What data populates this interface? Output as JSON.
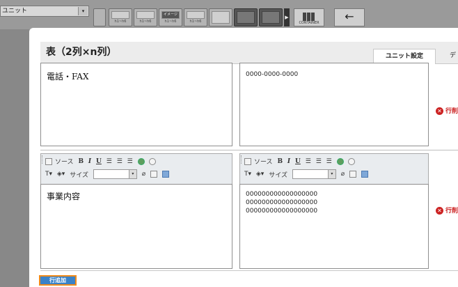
{
  "toolbar": {
    "unit_select_value": "ユニット",
    "buttons": [
      {
        "label": "h1~h6"
      },
      {
        "label": "h1~h6"
      },
      {
        "label": "h1~h6"
      },
      {
        "label": "h1~h6"
      }
    ],
    "image_badge": "イメージ",
    "container_label": "CONTAINER",
    "back_arrow": "←"
  },
  "panel": {
    "title": "表（2列×n列）",
    "tabs": [
      {
        "label": "ユニット設定"
      },
      {
        "label": "デ"
      }
    ]
  },
  "rows": [
    {
      "left_text": "電話・FAX",
      "right_lines": [
        "0000-0000-0000"
      ],
      "delete_label": "行削"
    },
    {
      "left_text": "事業内容",
      "right_lines": [
        "000000000000000000",
        "000000000000000000",
        "000000000000000000"
      ],
      "delete_label": "行削"
    }
  ],
  "editor_toolbar": {
    "source_label": "ソース",
    "bold": "B",
    "italic": "I",
    "underline": "U",
    "size_label": "サイズ"
  },
  "add_row_label": "行追加"
}
